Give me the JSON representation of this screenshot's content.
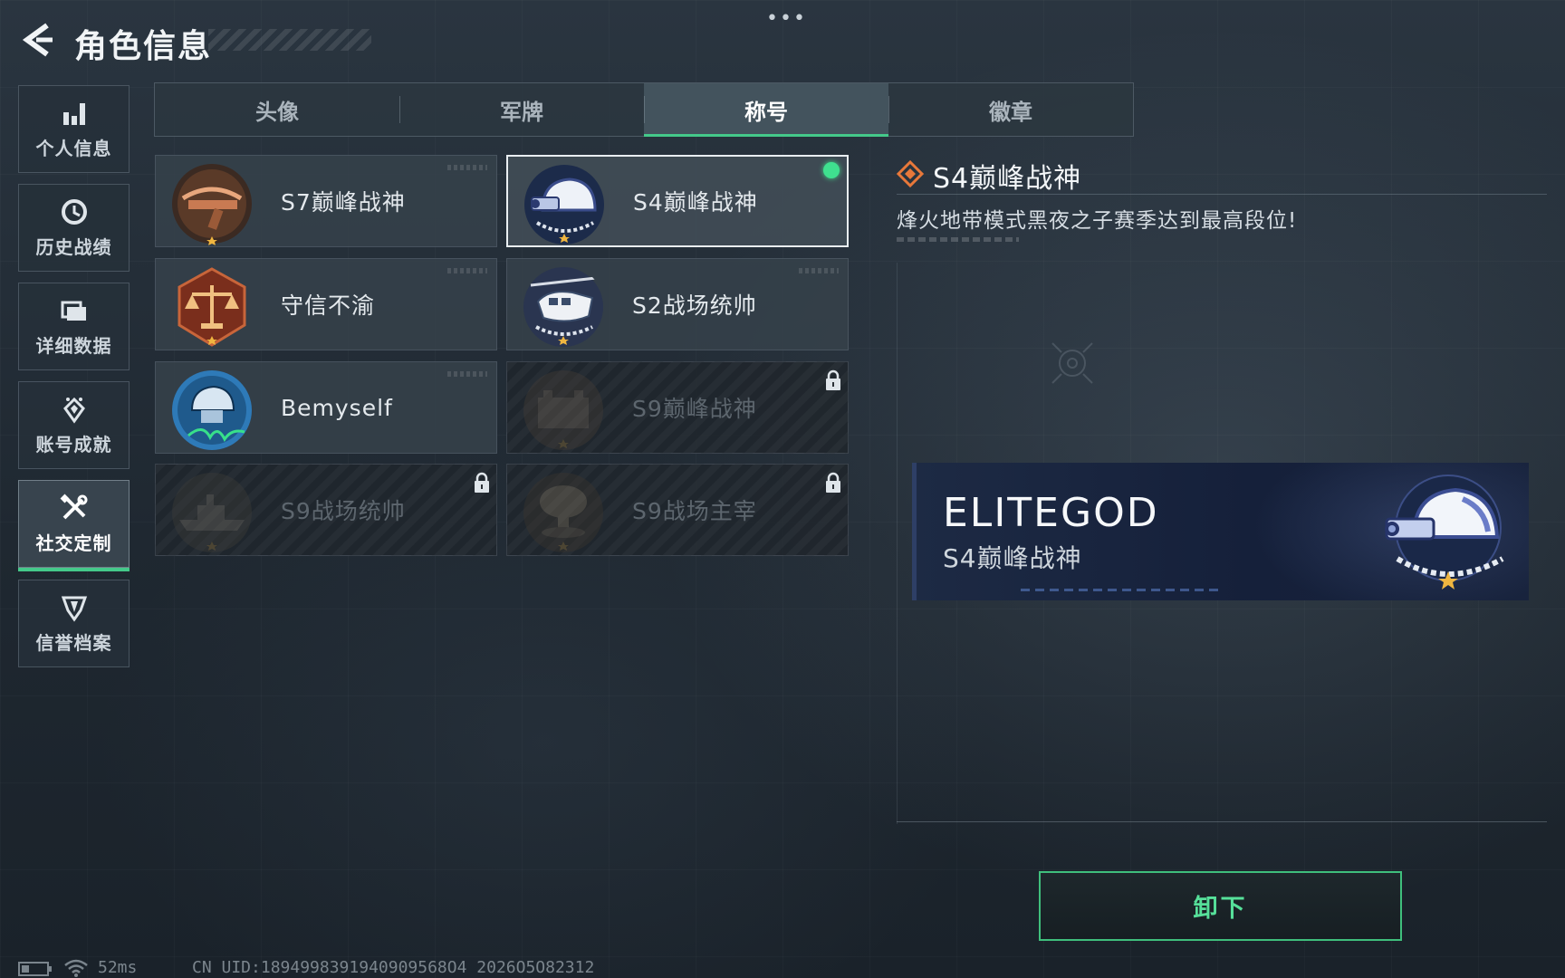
{
  "header": {
    "title": "角色信息",
    "more": "•••"
  },
  "sidebar": {
    "items": [
      {
        "label": "个人信息",
        "icon": "bar-chart-icon",
        "active": false
      },
      {
        "label": "历史战绩",
        "icon": "clock-icon",
        "active": false
      },
      {
        "label": "详细数据",
        "icon": "folder-icon",
        "active": false
      },
      {
        "label": "账号成就",
        "icon": "achievement-icon",
        "active": false
      },
      {
        "label": "社交定制",
        "icon": "tools-icon",
        "active": true
      },
      {
        "label": "信誉档案",
        "icon": "shield-icon",
        "active": false
      }
    ]
  },
  "tabs": [
    {
      "label": "头像",
      "active": false
    },
    {
      "label": "军牌",
      "active": false
    },
    {
      "label": "称号",
      "active": true
    },
    {
      "label": "徽章",
      "active": false
    }
  ],
  "titles": [
    {
      "label": "S7巅峰战神",
      "emblem": "crossbow-emblem-icon",
      "locked": false,
      "selected": false,
      "equipped": false
    },
    {
      "label": "S4巅峰战神",
      "emblem": "night-vision-helmet-emblem-icon",
      "locked": false,
      "selected": true,
      "equipped": true
    },
    {
      "label": "守信不渝",
      "emblem": "scales-emblem-icon",
      "locked": false,
      "selected": false,
      "equipped": false
    },
    {
      "label": "S2战场统帅",
      "emblem": "helicopter-emblem-icon",
      "locked": false,
      "selected": false,
      "equipped": false
    },
    {
      "label": "Bemyself",
      "emblem": "signature-helmet-emblem-icon",
      "locked": false,
      "selected": false,
      "equipped": false
    },
    {
      "label": "S9巅峰战神",
      "emblem": "fortress-emblem-icon",
      "locked": true,
      "selected": false,
      "equipped": false
    },
    {
      "label": "S9战场统帅",
      "emblem": "warship-emblem-icon",
      "locked": true,
      "selected": false,
      "equipped": false
    },
    {
      "label": "S9战场主宰",
      "emblem": "mushroom-cloud-emblem-icon",
      "locked": true,
      "selected": false,
      "equipped": false
    }
  ],
  "detail": {
    "title": "S4巅峰战神",
    "description": "烽火地带模式黑夜之子赛季达到最高段位!",
    "preview": {
      "player_name": "ELITEGOD",
      "title": "S4巅峰战神"
    },
    "action_label": "卸下"
  },
  "footer": {
    "ping": "52ms",
    "uid": "CN UID:1894998391940909568O4 2026O5O82312"
  },
  "colors": {
    "accent_green": "#44c98a",
    "equipped_dot": "#3fe08f",
    "button_text": "#56e09a",
    "banner_bg": "#1d2a44",
    "detail_icon": "#e8783a"
  }
}
